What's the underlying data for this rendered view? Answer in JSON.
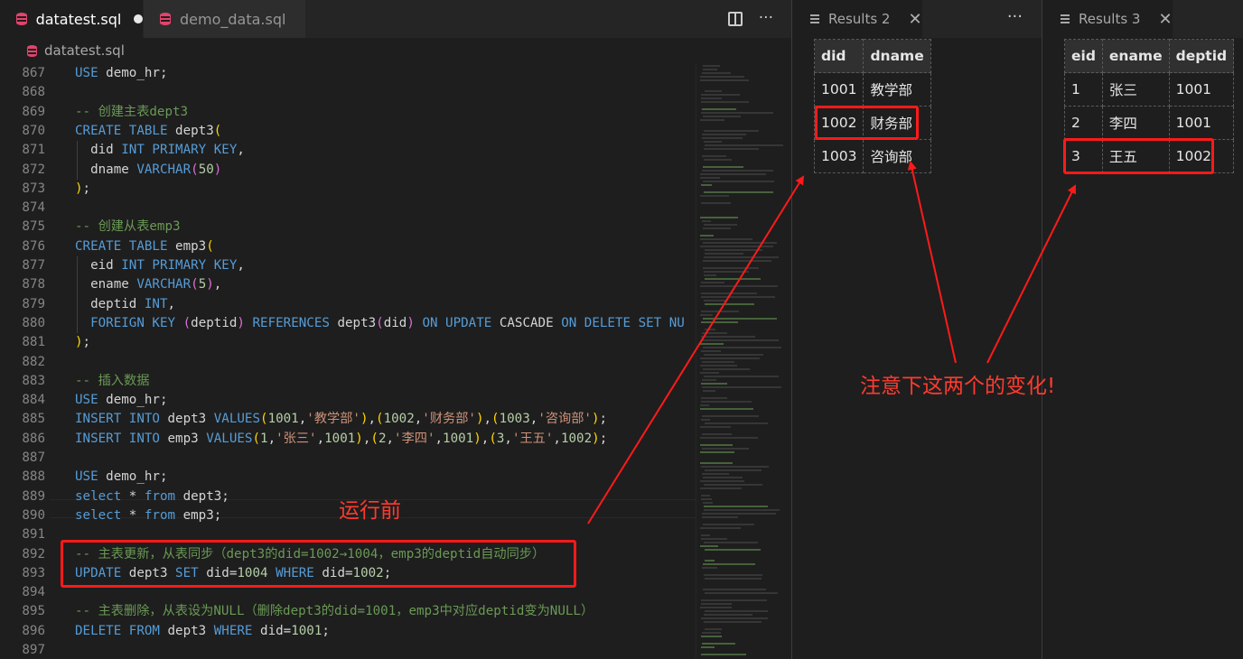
{
  "editor": {
    "tabs": [
      {
        "label": "datatest.sql",
        "dirty": true
      },
      {
        "label": "demo_data.sql",
        "dirty": false
      }
    ],
    "breadcrumb": "datatest.sql",
    "actions": {
      "split_icon": "split-editor-icon",
      "more": "···"
    }
  },
  "code_lines": [
    {
      "n": "867",
      "t": [
        [
          "kw",
          "USE"
        ],
        [
          "pu",
          " demo_hr;"
        ]
      ]
    },
    {
      "n": "868",
      "t": []
    },
    {
      "n": "869",
      "t": [
        [
          "cm",
          "-- 创建主表dept3"
        ]
      ]
    },
    {
      "n": "870",
      "t": [
        [
          "kw",
          "CREATE TABLE"
        ],
        [
          "pu",
          " dept3"
        ],
        [
          "br1",
          "("
        ]
      ]
    },
    {
      "n": "871",
      "t": [
        [
          "pu",
          "  did "
        ],
        [
          "kw",
          "INT PRIMARY KEY"
        ],
        [
          "pu",
          ","
        ]
      ]
    },
    {
      "n": "872",
      "t": [
        [
          "pu",
          "  dname "
        ],
        [
          "kw",
          "VARCHAR"
        ],
        [
          "br2",
          "("
        ],
        [
          "nm",
          "50"
        ],
        [
          "br2",
          ")"
        ]
      ]
    },
    {
      "n": "873",
      "t": [
        [
          "br1",
          ")"
        ],
        [
          "pu",
          ";"
        ]
      ]
    },
    {
      "n": "874",
      "t": []
    },
    {
      "n": "875",
      "t": [
        [
          "cm",
          "-- 创建从表emp3"
        ]
      ]
    },
    {
      "n": "876",
      "t": [
        [
          "kw",
          "CREATE TABLE"
        ],
        [
          "pu",
          " emp3"
        ],
        [
          "br1",
          "("
        ]
      ]
    },
    {
      "n": "877",
      "t": [
        [
          "pu",
          "  eid "
        ],
        [
          "kw",
          "INT PRIMARY KEY"
        ],
        [
          "pu",
          ","
        ]
      ]
    },
    {
      "n": "878",
      "t": [
        [
          "pu",
          "  ename "
        ],
        [
          "kw",
          "VARCHAR"
        ],
        [
          "br2",
          "("
        ],
        [
          "nm",
          "5"
        ],
        [
          "br2",
          ")"
        ],
        [
          "pu",
          ","
        ]
      ]
    },
    {
      "n": "879",
      "t": [
        [
          "pu",
          "  deptid "
        ],
        [
          "kw",
          "INT"
        ],
        [
          "pu",
          ","
        ]
      ]
    },
    {
      "n": "880",
      "t": [
        [
          "pu",
          "  "
        ],
        [
          "kw",
          "FOREIGN KEY"
        ],
        [
          "pu",
          " "
        ],
        [
          "br2",
          "("
        ],
        [
          "pu",
          "deptid"
        ],
        [
          "br2",
          ")"
        ],
        [
          "pu",
          " "
        ],
        [
          "kw",
          "REFERENCES"
        ],
        [
          "pu",
          " dept3"
        ],
        [
          "br2",
          "("
        ],
        [
          "pu",
          "did"
        ],
        [
          "br2",
          ")"
        ],
        [
          "pu",
          " "
        ],
        [
          "kw",
          "ON UPDATE"
        ],
        [
          "pu",
          " CASCADE "
        ],
        [
          "kw",
          "ON DELETE SET NU"
        ]
      ]
    },
    {
      "n": "881",
      "t": [
        [
          "br1",
          ")"
        ],
        [
          "pu",
          ";"
        ]
      ]
    },
    {
      "n": "882",
      "t": []
    },
    {
      "n": "883",
      "t": [
        [
          "cm",
          "-- 插入数据"
        ]
      ]
    },
    {
      "n": "884",
      "t": [
        [
          "kw",
          "USE"
        ],
        [
          "pu",
          " demo_hr;"
        ]
      ]
    },
    {
      "n": "885",
      "t": [
        [
          "kw",
          "INSERT INTO"
        ],
        [
          "pu",
          " dept3 "
        ],
        [
          "kw",
          "VALUES"
        ],
        [
          "br1",
          "("
        ],
        [
          "nm",
          "1001"
        ],
        [
          "pu",
          ","
        ],
        [
          "st",
          "'教学部'"
        ],
        [
          "br1",
          ")"
        ],
        [
          "pu",
          ","
        ],
        [
          "br1",
          "("
        ],
        [
          "nm",
          "1002"
        ],
        [
          "pu",
          ","
        ],
        [
          "st",
          "'财务部'"
        ],
        [
          "br1",
          ")"
        ],
        [
          "pu",
          ","
        ],
        [
          "br1",
          "("
        ],
        [
          "nm",
          "1003"
        ],
        [
          "pu",
          ","
        ],
        [
          "st",
          "'咨询部'"
        ],
        [
          "br1",
          ")"
        ],
        [
          "pu",
          ";"
        ]
      ]
    },
    {
      "n": "886",
      "t": [
        [
          "kw",
          "INSERT INTO"
        ],
        [
          "pu",
          " emp3 "
        ],
        [
          "kw",
          "VALUES"
        ],
        [
          "br1",
          "("
        ],
        [
          "nm",
          "1"
        ],
        [
          "pu",
          ","
        ],
        [
          "st",
          "'张三'"
        ],
        [
          "pu",
          ","
        ],
        [
          "nm",
          "1001"
        ],
        [
          "br1",
          ")"
        ],
        [
          "pu",
          ","
        ],
        [
          "br1",
          "("
        ],
        [
          "nm",
          "2"
        ],
        [
          "pu",
          ","
        ],
        [
          "st",
          "'李四'"
        ],
        [
          "pu",
          ","
        ],
        [
          "nm",
          "1001"
        ],
        [
          "br1",
          ")"
        ],
        [
          "pu",
          ","
        ],
        [
          "br1",
          "("
        ],
        [
          "nm",
          "3"
        ],
        [
          "pu",
          ","
        ],
        [
          "st",
          "'王五'"
        ],
        [
          "pu",
          ","
        ],
        [
          "nm",
          "1002"
        ],
        [
          "br1",
          ")"
        ],
        [
          "pu",
          ";"
        ]
      ]
    },
    {
      "n": "887",
      "t": []
    },
    {
      "n": "888",
      "t": [
        [
          "kw",
          "USE"
        ],
        [
          "pu",
          " demo_hr;"
        ]
      ]
    },
    {
      "n": "889",
      "t": [
        [
          "kw",
          "select"
        ],
        [
          "pu",
          " * "
        ],
        [
          "kw",
          "from"
        ],
        [
          "pu",
          " dept3;"
        ]
      ]
    },
    {
      "n": "890",
      "t": [
        [
          "kw",
          "select"
        ],
        [
          "pu",
          " * "
        ],
        [
          "kw",
          "from"
        ],
        [
          "pu",
          " emp3;"
        ]
      ]
    },
    {
      "n": "891",
      "t": []
    },
    {
      "n": "892",
      "t": [
        [
          "cm",
          "-- 主表更新，从表同步（dept3的did=1002→1004，emp3的deptid自动同步）"
        ]
      ]
    },
    {
      "n": "893",
      "t": [
        [
          "kw",
          "UPDATE"
        ],
        [
          "pu",
          " dept3 "
        ],
        [
          "kw",
          "SET"
        ],
        [
          "pu",
          " did="
        ],
        [
          "nm",
          "1004"
        ],
        [
          "pu",
          " "
        ],
        [
          "kw",
          "WHERE"
        ],
        [
          "pu",
          " did="
        ],
        [
          "nm",
          "1002"
        ],
        [
          "pu",
          ";"
        ]
      ]
    },
    {
      "n": "894",
      "t": []
    },
    {
      "n": "895",
      "t": [
        [
          "cm",
          "-- 主表删除，从表设为NULL（删除dept3的did=1001，emp3中对应deptid变为NULL）"
        ]
      ]
    },
    {
      "n": "896",
      "t": [
        [
          "kw",
          "DELETE FROM"
        ],
        [
          "pu",
          " dept3 "
        ],
        [
          "kw",
          "WHERE"
        ],
        [
          "pu",
          " did="
        ],
        [
          "nm",
          "1001"
        ],
        [
          "pu",
          ";"
        ]
      ]
    },
    {
      "n": "897",
      "t": []
    }
  ],
  "results2": {
    "tab_label": "Results 2",
    "close": "✕",
    "more": "···",
    "columns": [
      "did",
      "dname"
    ],
    "rows": [
      [
        "1001",
        "教学部"
      ],
      [
        "1002",
        "财务部"
      ],
      [
        "1003",
        "咨询部"
      ]
    ]
  },
  "results3": {
    "tab_label": "Results 3",
    "close": "✕",
    "columns": [
      "eid",
      "ename",
      "deptid"
    ],
    "rows": [
      [
        "1",
        "张三",
        "1001"
      ],
      [
        "2",
        "李四",
        "1001"
      ],
      [
        "3",
        "王五",
        "1002"
      ]
    ]
  },
  "annotations": {
    "before_run": "运行前",
    "note": "注意下这两个的变化!",
    "color": "#ff1a1a"
  },
  "colors": {
    "editor_bg": "#1e1e1e",
    "keyword": "#569cd6",
    "comment": "#6a9955",
    "string": "#ce9178",
    "number": "#b5cea8",
    "db_icon": "#e2446c"
  }
}
